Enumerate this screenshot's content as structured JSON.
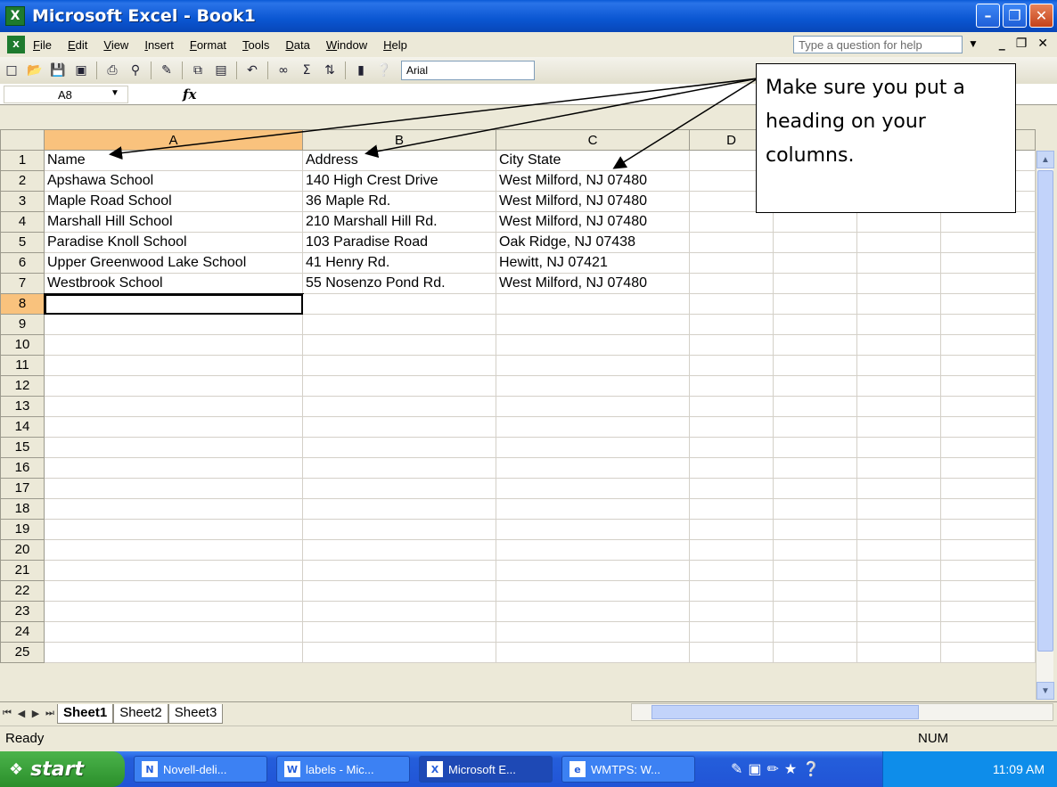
{
  "window": {
    "title": "Microsoft Excel - Book1",
    "app_icon": "X"
  },
  "menu": {
    "items": [
      "File",
      "Edit",
      "View",
      "Insert",
      "Format",
      "Tools",
      "Data",
      "Window",
      "Help"
    ],
    "help_placeholder": "Type a question for help"
  },
  "toolbar": {
    "font": "Arial"
  },
  "formula_bar": {
    "name_box": "A8",
    "fx": "fx"
  },
  "grid": {
    "columns": [
      "A",
      "B",
      "C",
      "D"
    ],
    "selected_column": "A",
    "rows": [
      {
        "num": "1",
        "cells": [
          "Name",
          "Address",
          "City State"
        ]
      },
      {
        "num": "2",
        "cells": [
          "Apshawa School",
          "140 High Crest Drive",
          "West Milford, NJ 07480"
        ]
      },
      {
        "num": "3",
        "cells": [
          "Maple Road School",
          "36 Maple Rd.",
          "West Milford, NJ 07480"
        ]
      },
      {
        "num": "4",
        "cells": [
          "Marshall Hill School",
          "210 Marshall Hill Rd.",
          "West Milford, NJ 07480"
        ]
      },
      {
        "num": "5",
        "cells": [
          "Paradise Knoll School",
          "103 Paradise Road",
          "Oak Ridge, NJ 07438"
        ]
      },
      {
        "num": "6",
        "cells": [
          "Upper Greenwood Lake School",
          "41 Henry Rd.",
          "Hewitt, NJ 07421"
        ]
      },
      {
        "num": "7",
        "cells": [
          "Westbrook School",
          "55 Nosenzo Pond Rd.",
          "West Milford, NJ 07480"
        ]
      },
      {
        "num": "8",
        "cells": [
          "",
          "",
          ""
        ]
      },
      {
        "num": "9",
        "cells": [
          "",
          "",
          ""
        ]
      },
      {
        "num": "10",
        "cells": [
          "",
          "",
          ""
        ]
      },
      {
        "num": "11",
        "cells": [
          "",
          "",
          ""
        ]
      },
      {
        "num": "12",
        "cells": [
          "",
          "",
          ""
        ]
      },
      {
        "num": "13",
        "cells": [
          "",
          "",
          ""
        ]
      },
      {
        "num": "14",
        "cells": [
          "",
          "",
          ""
        ]
      },
      {
        "num": "15",
        "cells": [
          "",
          "",
          ""
        ]
      },
      {
        "num": "16",
        "cells": [
          "",
          "",
          ""
        ]
      },
      {
        "num": "17",
        "cells": [
          "",
          "",
          ""
        ]
      },
      {
        "num": "18",
        "cells": [
          "",
          "",
          ""
        ]
      },
      {
        "num": "19",
        "cells": [
          "",
          "",
          ""
        ]
      },
      {
        "num": "20",
        "cells": [
          "",
          "",
          ""
        ]
      },
      {
        "num": "21",
        "cells": [
          "",
          "",
          ""
        ]
      },
      {
        "num": "22",
        "cells": [
          "",
          "",
          ""
        ]
      },
      {
        "num": "23",
        "cells": [
          "",
          "",
          ""
        ]
      },
      {
        "num": "24",
        "cells": [
          "",
          "",
          ""
        ]
      },
      {
        "num": "25",
        "cells": [
          "",
          "",
          ""
        ]
      }
    ]
  },
  "sheets": {
    "tabs": [
      "Sheet1",
      "Sheet2",
      "Sheet3"
    ],
    "active": "Sheet1"
  },
  "status": {
    "text": "Ready",
    "num": "NUM"
  },
  "taskbar": {
    "start_label": "start",
    "items": [
      "Novell-deli...",
      "labels - Mic...",
      "Microsoft E...",
      "WMTPS: W..."
    ],
    "active_item": "Microsoft E...",
    "clock": "11:09 AM"
  },
  "callout": {
    "text": "Make sure you put a heading on your columns."
  }
}
